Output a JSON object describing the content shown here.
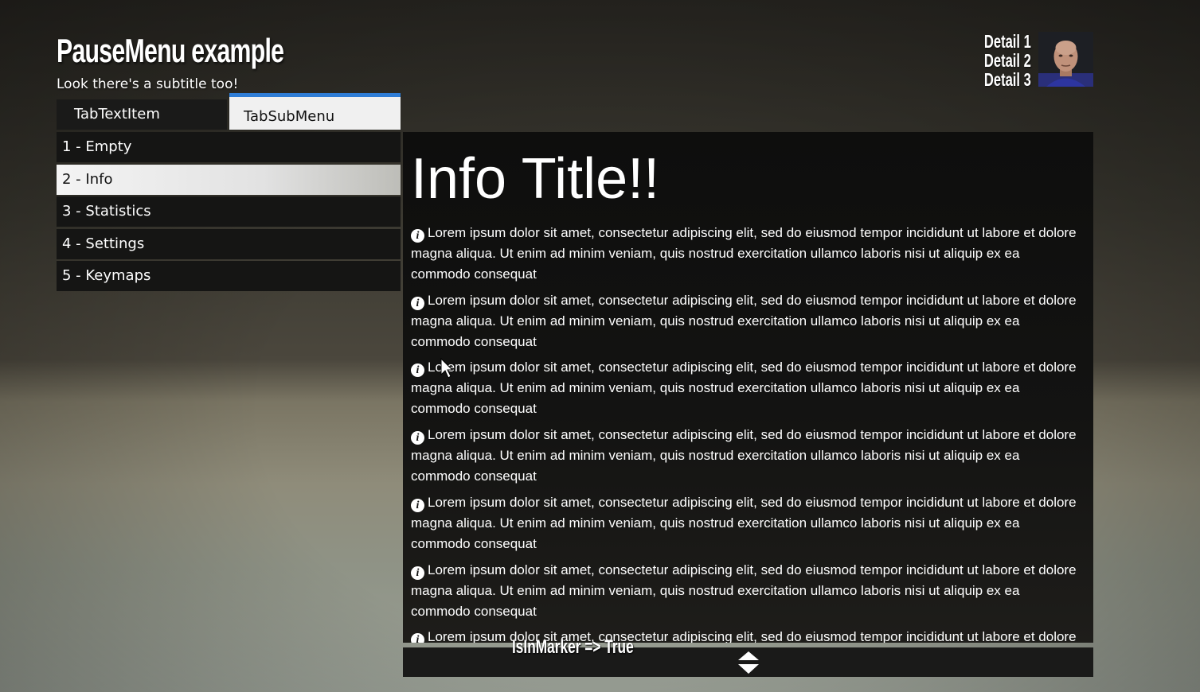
{
  "header": {
    "title": "PauseMenu example",
    "subtitle": "Look there's a subtitle too!"
  },
  "tabs": [
    {
      "label": "TabTextItem",
      "active": false
    },
    {
      "label": "TabSubMenu",
      "active": true
    }
  ],
  "menu": {
    "items": [
      {
        "label": "1 - Empty"
      },
      {
        "label": "2 - Info",
        "selected": true
      },
      {
        "label": "3 - Statistics"
      },
      {
        "label": "4 - Settings"
      },
      {
        "label": "5 - Keymaps"
      }
    ]
  },
  "info": {
    "title": "Info Title!!",
    "icon": "info-icon",
    "paragraphs": [
      "Lorem ipsum dolor sit amet, consectetur adipiscing elit, sed do eiusmod tempor incididunt ut labore et dolore magna aliqua. Ut enim ad minim veniam, quis nostrud exercitation ullamco laboris nisi ut aliquip ex ea commodo consequat",
      "Lorem ipsum dolor sit amet, consectetur adipiscing elit, sed do eiusmod tempor incididunt ut labore et dolore magna aliqua. Ut enim ad minim veniam, quis nostrud exercitation ullamco laboris nisi ut aliquip ex ea commodo consequat",
      "Lorem ipsum dolor sit amet, consectetur adipiscing elit, sed do eiusmod tempor incididunt ut labore et dolore magna aliqua. Ut enim ad minim veniam, quis nostrud exercitation ullamco laboris nisi ut aliquip ex ea commodo consequat",
      "Lorem ipsum dolor sit amet, consectetur adipiscing elit, sed do eiusmod tempor incididunt ut labore et dolore magna aliqua. Ut enim ad minim veniam, quis nostrud exercitation ullamco laboris nisi ut aliquip ex ea commodo consequat",
      "Lorem ipsum dolor sit amet, consectetur adipiscing elit, sed do eiusmod tempor incididunt ut labore et dolore magna aliqua. Ut enim ad minim veniam, quis nostrud exercitation ullamco laboris nisi ut aliquip ex ea commodo consequat",
      "Lorem ipsum dolor sit amet, consectetur adipiscing elit, sed do eiusmod tempor incididunt ut labore et dolore magna aliqua. Ut enim ad minim veniam, quis nostrud exercitation ullamco laboris nisi ut aliquip ex ea commodo consequat",
      "Lorem ipsum dolor sit amet, consectetur adipiscing elit, sed do eiusmod tempor incididunt ut labore et dolore magna aliqua. Ut enim ad minim veniam, quis nostrud exercitation ullamco laboris nisi ut aliquip ex ea commodo consequat"
    ]
  },
  "footer": {
    "marker_text": "IsInMarker => True",
    "scroll_icon": "up-down-arrows-icon"
  },
  "player": {
    "details": [
      "Detail 1",
      "Detail 2",
      "Detail 3"
    ],
    "avatar_icon": "player-avatar"
  },
  "colors": {
    "accent": "#2f7dd6",
    "selected_bg": "#f0f0f0",
    "panel_bg": "#121211"
  }
}
